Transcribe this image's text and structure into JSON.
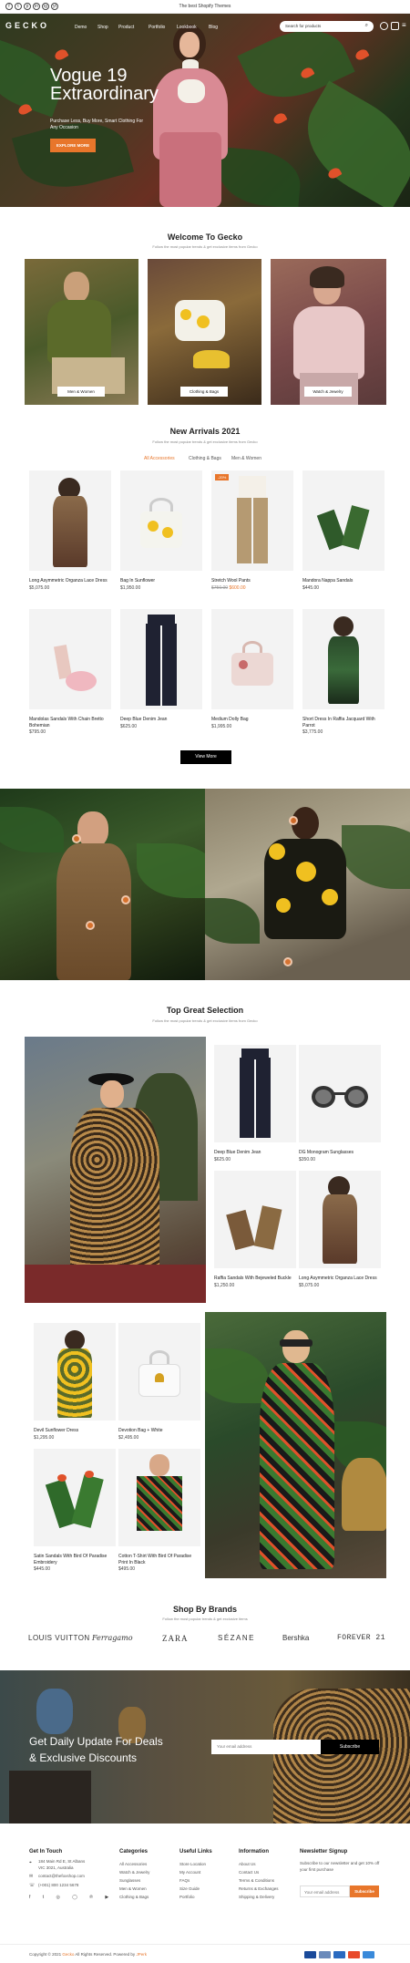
{
  "topbar": {
    "social": [
      "f",
      "t",
      "p",
      "in",
      "ig",
      "yt"
    ],
    "message": "The best Shopify Themes"
  },
  "header": {
    "logo": "GECKO",
    "nav": [
      "Demo",
      "Shop",
      "Product",
      "Portfolio",
      "Lookbook",
      "Blog"
    ],
    "search_placeholder": "Search for products"
  },
  "hero": {
    "title_line1": "Vogue 19",
    "title_line2": "Extraordinary",
    "subtitle": "Purchase Less, Buy More, Smart Clothing For Any Occasion",
    "cta": "EXPLORE MORE"
  },
  "welcome": {
    "title": "Welcome To Gecko",
    "subtitle": "Follow the most popular trends & get exclusive items from Gecko",
    "categories": [
      {
        "label": "Men & Women"
      },
      {
        "label": "Clothing & Bags"
      },
      {
        "label": "Watch & Jewelry"
      }
    ]
  },
  "arrivals": {
    "title": "New Arrivals 2021",
    "subtitle": "Follow the most popular trends & get exclusive items from Gecko",
    "tabs": [
      "All Accessories",
      "Clothing & Bags",
      "Men & Women"
    ],
    "products": [
      {
        "name": "Long Asymmetric Organza Lace Dress",
        "price": "$5,075.00"
      },
      {
        "name": "Bag In Sunflower",
        "price": "$1,950.00"
      },
      {
        "name": "Stretch Wool Pants",
        "old_price": "$750.00",
        "price": "$600.00",
        "badge": "-20%"
      },
      {
        "name": "Mandora Nappa Sandals",
        "price": "$445.00"
      },
      {
        "name": "Mandolas Sandals With Chain Bretto Bohemian",
        "price": "$795.00"
      },
      {
        "name": "Deep Blue Denim Jean",
        "price": "$625.00"
      },
      {
        "name": "Medium Dolly Bag",
        "price": "$1,995.00"
      },
      {
        "name": "Short Dress In Raffia Jacquard With Parrot",
        "price": "$3,775.00"
      }
    ],
    "view_more": "View More"
  },
  "selection": {
    "title": "Top Great Selection",
    "subtitle": "Follow the most popular trends & get exclusive items from Gecko",
    "products_a": [
      {
        "name": "Deep Blue Denim Jean",
        "price": "$625.00"
      },
      {
        "name": "DG Monogram Sunglasses",
        "price": "$350.00"
      },
      {
        "name": "Raffia Sandals With Bejeweled Buckle",
        "price": "$1,250.00"
      },
      {
        "name": "Long Asymmetric Organza Lace Dress",
        "price": "$5,075.00"
      }
    ],
    "products_b": [
      {
        "name": "Devil Sunflower Dress",
        "price": "$1,295.00"
      },
      {
        "name": "Devotion Bag + White",
        "price": "$2,495.00"
      },
      {
        "name": "Satin Sandals With Bird Of Paradise Embroidery",
        "price": "$445.00"
      },
      {
        "name": "Cotton T-Shirt With Bird Of Paradise Print In Black",
        "price": "$495.00"
      }
    ]
  },
  "brands": {
    "title": "Shop By Brands",
    "subtitle": "Follow the most popular trends & get exclusive items",
    "items": [
      "LOUIS VUITTON",
      "Ferragamo",
      "ZARA",
      "SÉZANE",
      "Bershka",
      "FOREVER 21"
    ]
  },
  "newsletter": {
    "title_line1": "Get Daily Update For Deals",
    "title_line2": "& Exclusive Discounts",
    "placeholder": "Your email address",
    "button": "Subscribe"
  },
  "footer": {
    "touch": {
      "title": "Get In Touch",
      "address": "184 Main Rd E, St Albans VIC 3021, Australia",
      "email": "contact@thefoxshop.com",
      "phone": "(+001) 800 1234 5678"
    },
    "categories": {
      "title": "Categories",
      "links": [
        "All Accessories",
        "Watch & Jewelry",
        "Sunglasses",
        "Men & Women",
        "Clothing & Bags"
      ]
    },
    "useful": {
      "title": "Useful Links",
      "links": [
        "Store Location",
        "My Account",
        "FAQs",
        "Size Guide",
        "Portfolio"
      ]
    },
    "information": {
      "title": "Information",
      "links": [
        "About Us",
        "Contact Us",
        "Terms & Conditions",
        "Returns & Exchanges",
        "Shipping & Delivery"
      ]
    },
    "signup": {
      "title": "Newsletter Signup",
      "text": "Subscribe to our newsletter and get 10% off your first purchase",
      "placeholder": "Your email address",
      "button": "Subscribe"
    },
    "copyright_prefix": "Copyright © 2021",
    "copyright_brand": "Gecko",
    "copyright_suffix": "All Rights Reserved. Powered by",
    "copyright_vendor": "JPerk",
    "payments": [
      "Visa",
      "Card",
      "PayPal",
      "MC",
      "Amex"
    ]
  }
}
